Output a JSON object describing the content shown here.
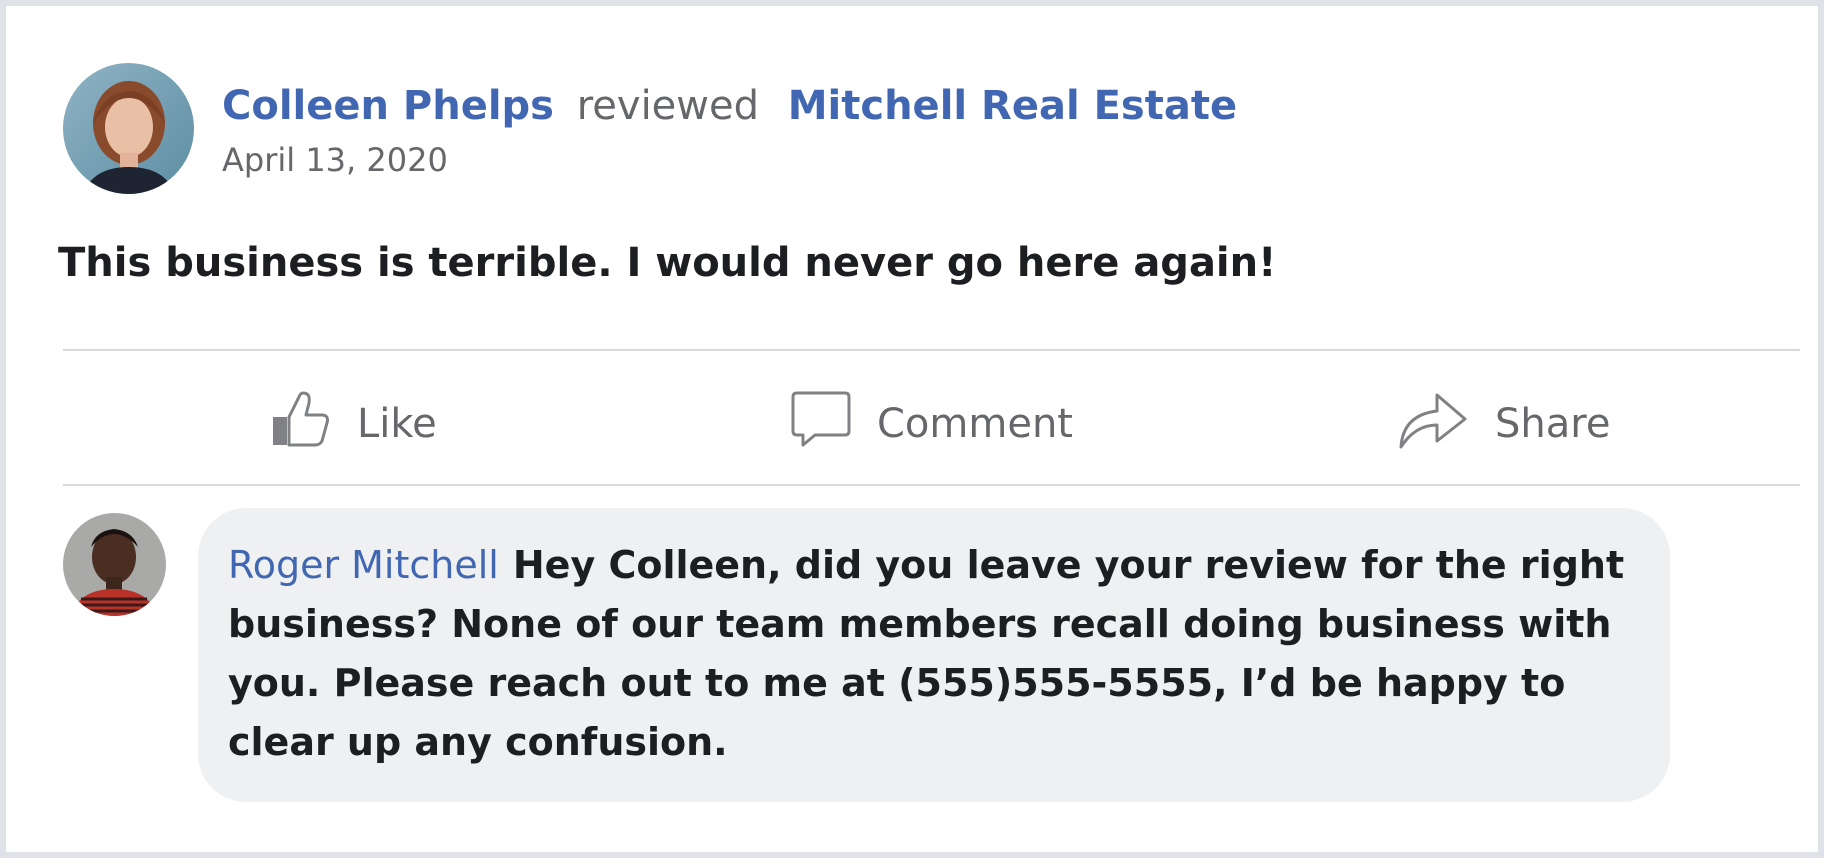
{
  "review": {
    "author": "Colleen Phelps",
    "verb": "reviewed",
    "business": "Mitchell Real Estate",
    "date": "April 13, 2020",
    "text": "This business is terrible. I would never go here again!"
  },
  "actions": {
    "like": "Like",
    "comment": "Comment",
    "share": "Share"
  },
  "comment": {
    "author": "Roger Mitchell",
    "text": "Hey Colleen, did you leave your review for the right business? None of our team members recall doing business with you. Please reach out to me at (555)555-5555, I’d be happy to clear up any confusion."
  },
  "colors": {
    "link": "#4267b2",
    "muted": "#65676b",
    "bubble": "#eff0f2",
    "divider": "#d7d9dc"
  },
  "icons": {
    "like": "thumbs-up-icon",
    "comment": "speech-bubble-icon",
    "share": "share-arrow-icon"
  }
}
